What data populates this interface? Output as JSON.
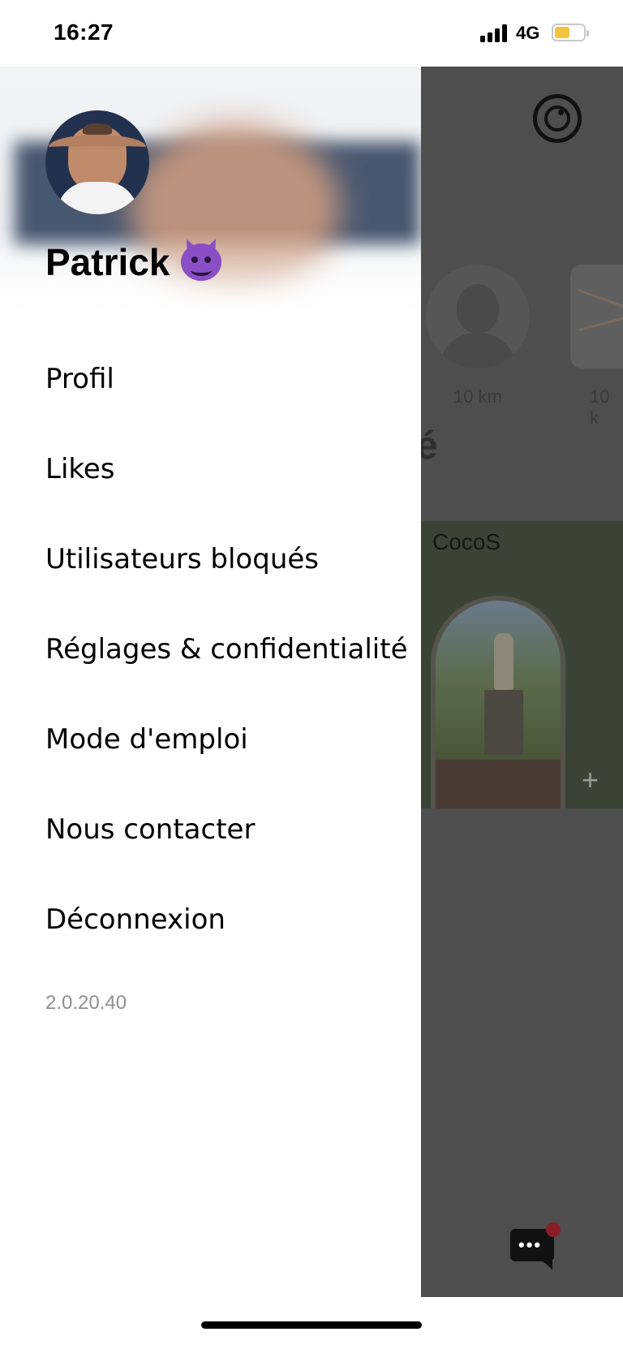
{
  "status_bar": {
    "time": "16:27",
    "network": "4G",
    "battery_level": 0.4,
    "battery_color": "#f2c53d"
  },
  "drawer": {
    "profile_name": "Patrick",
    "profile_emoji_icon": "smiling-devil-icon",
    "menu_items": [
      {
        "label": "Profil"
      },
      {
        "label": "Likes"
      },
      {
        "label": "Utilisateurs bloqués"
      },
      {
        "label": "Réglages & confidentialité"
      },
      {
        "label": "Mode d'emploi"
      },
      {
        "label": "Nous contacter"
      },
      {
        "label": "Déconnexion"
      }
    ],
    "version": "2.0.20.40"
  },
  "background": {
    "distance_1": "10 km",
    "distance_2": "10 k",
    "section_partial": "é",
    "card_title": "CocoS",
    "plus": "+",
    "chat_dots": "•••",
    "overlay_color": "#4e4e4e",
    "badge_color": "#8a1c24"
  }
}
